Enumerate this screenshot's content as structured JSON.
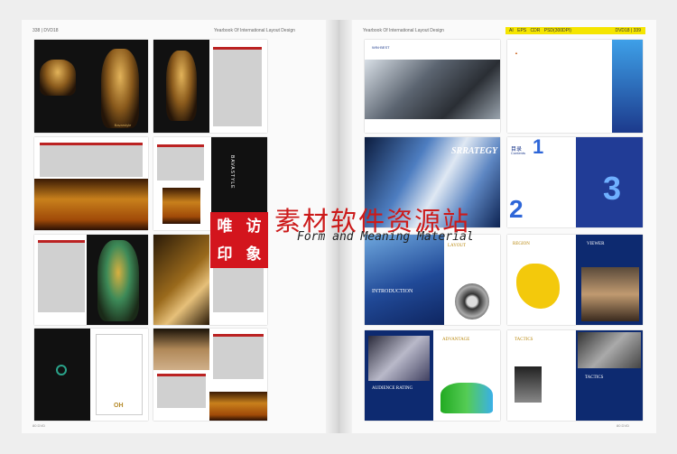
{
  "left_page": {
    "header_label": "338 | DVD18",
    "header_title": "Yearbook Of International Layout Design",
    "footer": "80 DVD"
  },
  "right_page": {
    "header_title": "Yearbook Of International Layout Design",
    "formats": [
      "AI",
      "EPS",
      "CDR",
      "PSD(300DPI)"
    ],
    "disc_page": "DVD18 | 339",
    "footer": "80 DVD"
  },
  "spreads": {
    "strategy_title": "SRRATEGY",
    "contents_cn": "目录",
    "contents_en": "Contents",
    "big_one": "1",
    "big_two": "2",
    "big_three": "3",
    "layout_label": "LAYOUT",
    "introduction_label": "INTRODUCTION",
    "region_label": "REGION",
    "viewer_label": "VIEWER",
    "advantage_label": "ADVANTAGE",
    "audience_label": "AUDIENCE RATING",
    "tactics_label": "TACTICS",
    "tactics_top_label": "TACTICS",
    "winbest_label": "WIN·BEST",
    "brand_script": "Bavarstyle",
    "vertical_brand": "BAVASTYLE",
    "gold_badge": "OH"
  },
  "watermark": {
    "stamp_chars": [
      "唯",
      "访",
      "印",
      "象"
    ],
    "title": "素材软件资源站",
    "subtitle": "Form and Meaning Material"
  }
}
